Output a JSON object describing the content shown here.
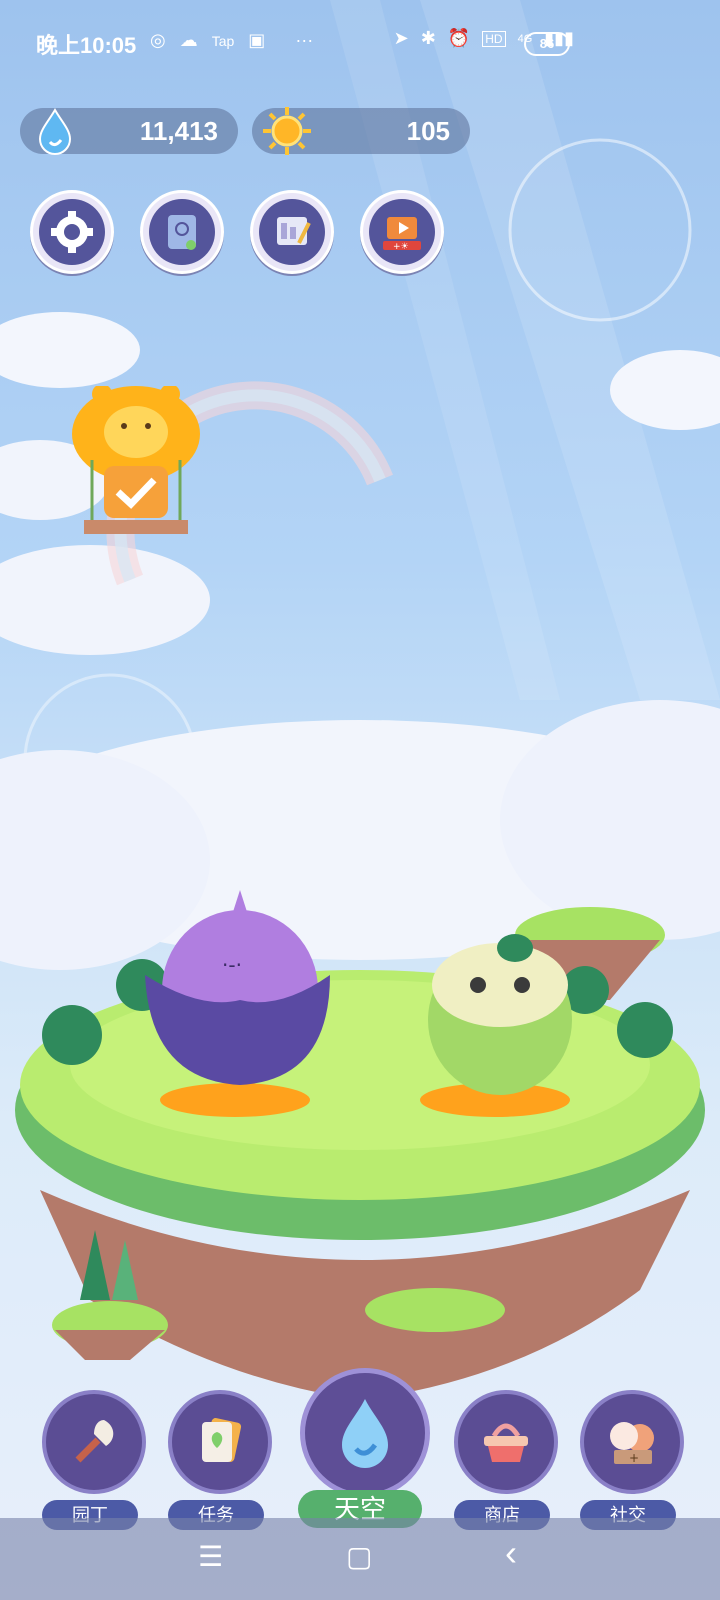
{
  "status_bar": {
    "time": "晚上10:05",
    "app_icons": [
      "Tap"
    ],
    "more": "···",
    "network": "4G",
    "hd": "HD",
    "battery": "86"
  },
  "resources": {
    "water": {
      "icon": "water-drop-icon",
      "value": "11,413"
    },
    "sun": {
      "icon": "sun-icon",
      "value": "105"
    }
  },
  "top_buttons": [
    {
      "name": "settings",
      "icon": "gear-icon"
    },
    {
      "name": "plant-book",
      "icon": "book-icon"
    },
    {
      "name": "board",
      "icon": "notes-icon"
    },
    {
      "name": "video-reward",
      "icon": "tv-icon"
    }
  ],
  "balloon": {
    "icon": "bear-balloon-icon",
    "status_icon": "check-icon"
  },
  "bottom_nav": [
    {
      "label": "园丁",
      "icon": "trowel-icon"
    },
    {
      "label": "任务",
      "icon": "task-card-icon"
    },
    {
      "label": "天空",
      "icon": "water-drop-icon"
    },
    {
      "label": "商店",
      "icon": "basket-icon"
    },
    {
      "label": "社交",
      "icon": "friends-icon"
    }
  ],
  "system_nav": {
    "menu": "☰",
    "home": "▢",
    "back": "‹"
  },
  "colors": {
    "nav_label_bg": "#4c5aa6",
    "center_label_bg": "#56b06d",
    "grass": "#b6e86b"
  }
}
